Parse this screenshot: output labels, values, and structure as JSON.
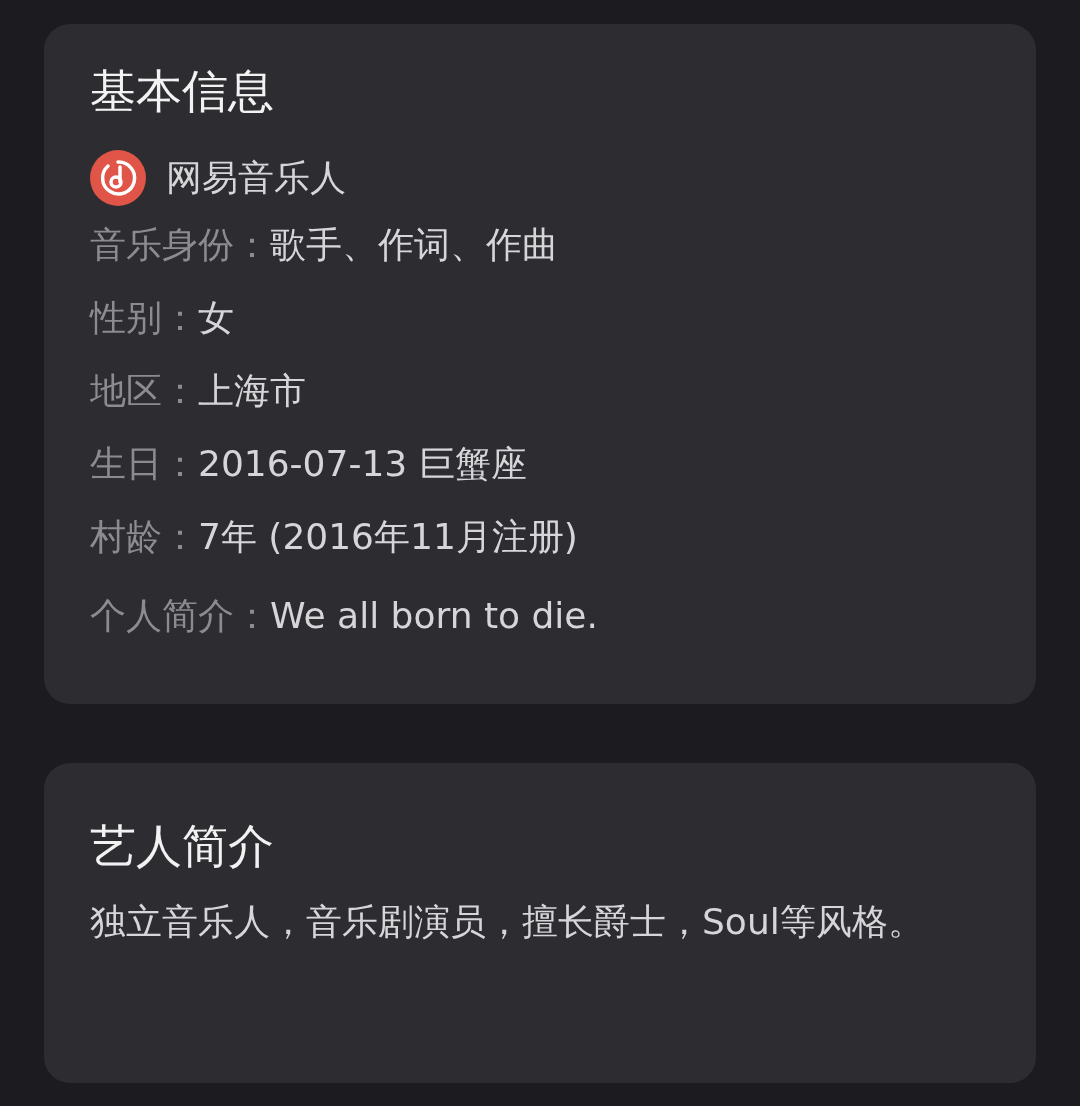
{
  "basic_info": {
    "title": "基本信息",
    "badge": {
      "label": "网易音乐人"
    },
    "fields": [
      {
        "label": "音乐身份：",
        "value": "歌手、作词、作曲"
      },
      {
        "label": "性别：",
        "value": "女"
      },
      {
        "label": "地区：",
        "value": "上海市"
      },
      {
        "label": "生日：",
        "value": "2016-07-13 巨蟹座"
      },
      {
        "label": "村龄：",
        "value": "7年 (2016年11月注册)"
      },
      {
        "label": "个人简介：",
        "value": "We all born to die."
      }
    ]
  },
  "artist_intro": {
    "title": "艺人简介",
    "text": "独立音乐人，音乐剧演员，擅长爵士，Soul等风格。"
  }
}
